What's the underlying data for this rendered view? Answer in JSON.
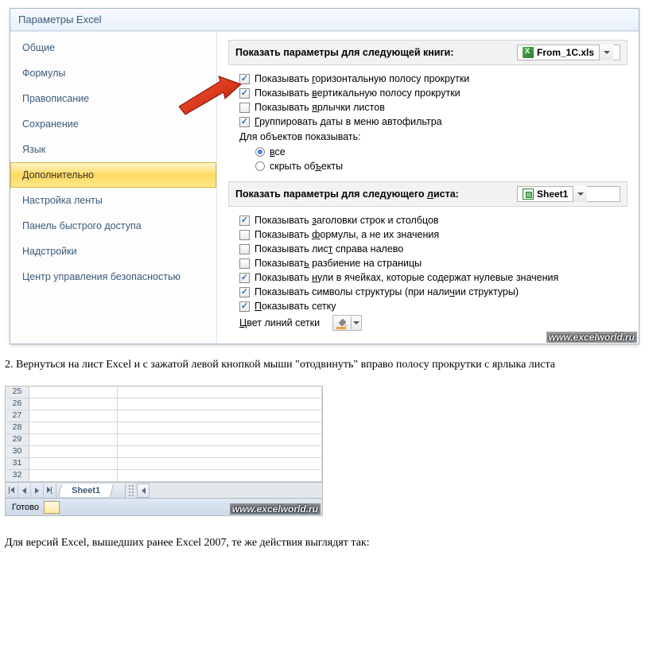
{
  "dialog": {
    "title": "Параметры Excel",
    "sidebar": {
      "items": [
        {
          "label": "Общие"
        },
        {
          "label": "Формулы"
        },
        {
          "label": "Правописание"
        },
        {
          "label": "Сохранение"
        },
        {
          "label": "Язык"
        },
        {
          "label": "Дополнительно",
          "selected": true
        },
        {
          "label": "Настройка ленты"
        },
        {
          "label": "Панель быстрого доступа"
        },
        {
          "label": "Надстройки"
        },
        {
          "label": "Центр управления безопасностью"
        }
      ]
    },
    "workbook_section": {
      "heading": "Показать параметры для следующей книги:",
      "selected": "From_1C.xls",
      "opts": [
        {
          "checked": true,
          "pre": "Показывать ",
          "u": "г",
          "post": "оризонтальную полосу прокрутки"
        },
        {
          "checked": true,
          "pre": "Показывать ",
          "u": "в",
          "post": "ертикальную полосу прокрутки"
        },
        {
          "checked": false,
          "pre": "Показывать ",
          "u": "я",
          "post": "рлычки листов"
        },
        {
          "checked": true,
          "pre": "",
          "u": "Г",
          "post": "руппировать даты в меню автофильтра"
        }
      ],
      "objects_label": "Для объектов показывать:",
      "radios": [
        {
          "checked": true,
          "u": "в",
          "post": "се"
        },
        {
          "checked": false,
          "pre": "скрыть об",
          "u": "ъ",
          "post": "екты"
        }
      ]
    },
    "sheet_section": {
      "heading": "Показать параметры для следующего ",
      "heading_u": "л",
      "heading_post": "иста:",
      "selected": "Sheet1",
      "opts": [
        {
          "checked": true,
          "pre": "Показывать ",
          "u": "з",
          "post": "аголовки строк и столбцов"
        },
        {
          "checked": false,
          "pre": "Показывать ",
          "u": "ф",
          "post": "ормулы, а не их значения"
        },
        {
          "checked": false,
          "pre": "Показывать лис",
          "u": "т",
          "post": " справа налево"
        },
        {
          "checked": false,
          "pre": "Показыват",
          "u": "ь",
          "post": " разбиение на страницы"
        },
        {
          "checked": true,
          "pre": "Показывать ",
          "u": "н",
          "post": "ули в ячейках, которые содержат нулевые значения"
        },
        {
          "checked": true,
          "pre": "Показывать символы структуры (при нали",
          "u": "ч",
          "post": "ии структуры)"
        },
        {
          "checked": true,
          "pre": "",
          "u": "П",
          "post": "оказывать сетку"
        }
      ],
      "gridcolor_pre": "",
      "gridcolor_u": "Ц",
      "gridcolor_post": "вет линий сетки"
    }
  },
  "article": {
    "p1": "2. Вернуться на лист Excel и с зажатой левой кнопкой мыши \"отодвинуть\" вправо полосу прокрутки с ярлыка листа",
    "p2": "Для версий Excel, вышедших ранее Excel 2007, те же действия выглядят так:"
  },
  "sheet": {
    "rows": [
      "25",
      "26",
      "27",
      "28",
      "29",
      "30",
      "31",
      "32"
    ],
    "tab": "Sheet1",
    "status": "Готово"
  },
  "watermark": "www.excelworld.ru"
}
